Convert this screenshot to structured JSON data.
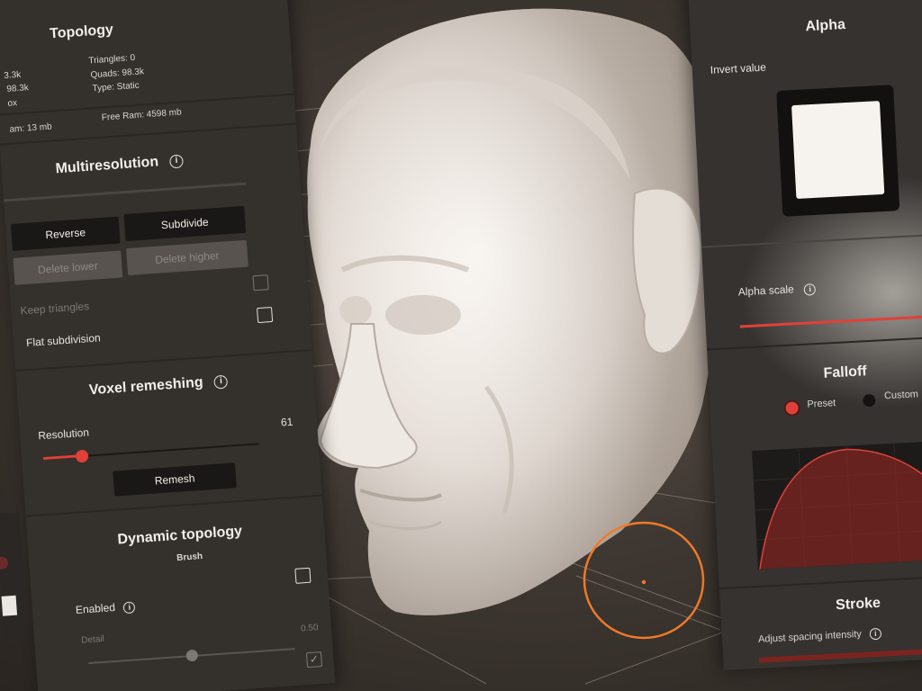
{
  "topology": {
    "title": "Topology",
    "vertices_label": "3.3k",
    "faces_label": "98.3k",
    "box_label": "ox",
    "triangles": "Triangles: 0",
    "quads": "Quads: 98.3k",
    "type": "Type: Static",
    "used_ram": "am:  13 mb",
    "free_ram": "Free Ram:  4598 mb"
  },
  "multiresolution": {
    "title": "Multiresolution",
    "reverse_label": "Reverse",
    "subdivide_label": "Subdivide",
    "delete_lower_label": "Delete lower",
    "delete_higher_label": "Delete higher",
    "keep_triangles_label": "Keep triangles",
    "flat_subdivision_label": "Flat subdivision"
  },
  "voxel": {
    "title": "Voxel remeshing",
    "resolution_label": "Resolution",
    "resolution_value": "61",
    "resolution_fraction": 0.18,
    "remesh_label": "Remesh"
  },
  "dynamic": {
    "title": "Dynamic topology",
    "brush_label": "Brush",
    "enabled_label": "Enabled",
    "detail_label": "Detail",
    "detail_value": "0.50",
    "detail_fraction": 0.5
  },
  "alpha": {
    "title": "Alpha",
    "invert_label": "Invert value",
    "scale_label": "Alpha scale"
  },
  "falloff": {
    "title": "Falloff",
    "preset_label": "Preset",
    "custom_label": "Custom"
  },
  "stroke": {
    "title": "Stroke",
    "spacing_label": "Adjust spacing intensity"
  },
  "icons": {
    "info": "info-icon",
    "checkbox": "checkbox-icon",
    "brush_cursor": "brush-cursor-icon"
  },
  "colors": {
    "accent": "#e0403a",
    "brush_ring": "#f07a2a",
    "panel": "#34302c"
  }
}
